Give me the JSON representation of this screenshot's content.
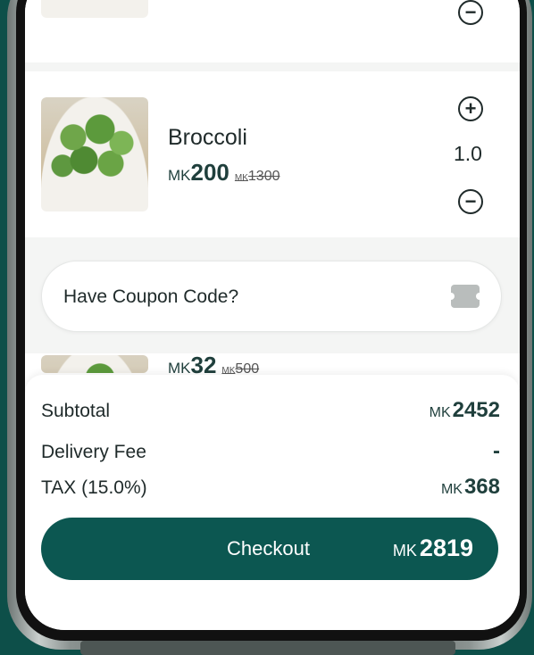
{
  "cart": {
    "items": [
      {
        "name": "Broccoli",
        "currency": "MK",
        "price": "200",
        "old_currency": "MK",
        "old_price": "1300",
        "quantity": "1.0"
      },
      {
        "currency": "MK",
        "price": "32",
        "old_currency": "MK",
        "old_price": "500"
      }
    ],
    "coupon_label": "Have Coupon Code?"
  },
  "summary": {
    "subtotal_label": "Subtotal",
    "subtotal_currency": "MK",
    "subtotal_value": "2452",
    "delivery_label": "Delivery Fee",
    "delivery_value": "-",
    "tax_label": "TAX (15.0%)",
    "tax_currency": "MK",
    "tax_value": "368",
    "checkout_label": "Checkout",
    "total_currency": "MK",
    "total_value": "2819"
  },
  "colors": {
    "brand": "#0c5751",
    "background": "#0d4f49"
  }
}
